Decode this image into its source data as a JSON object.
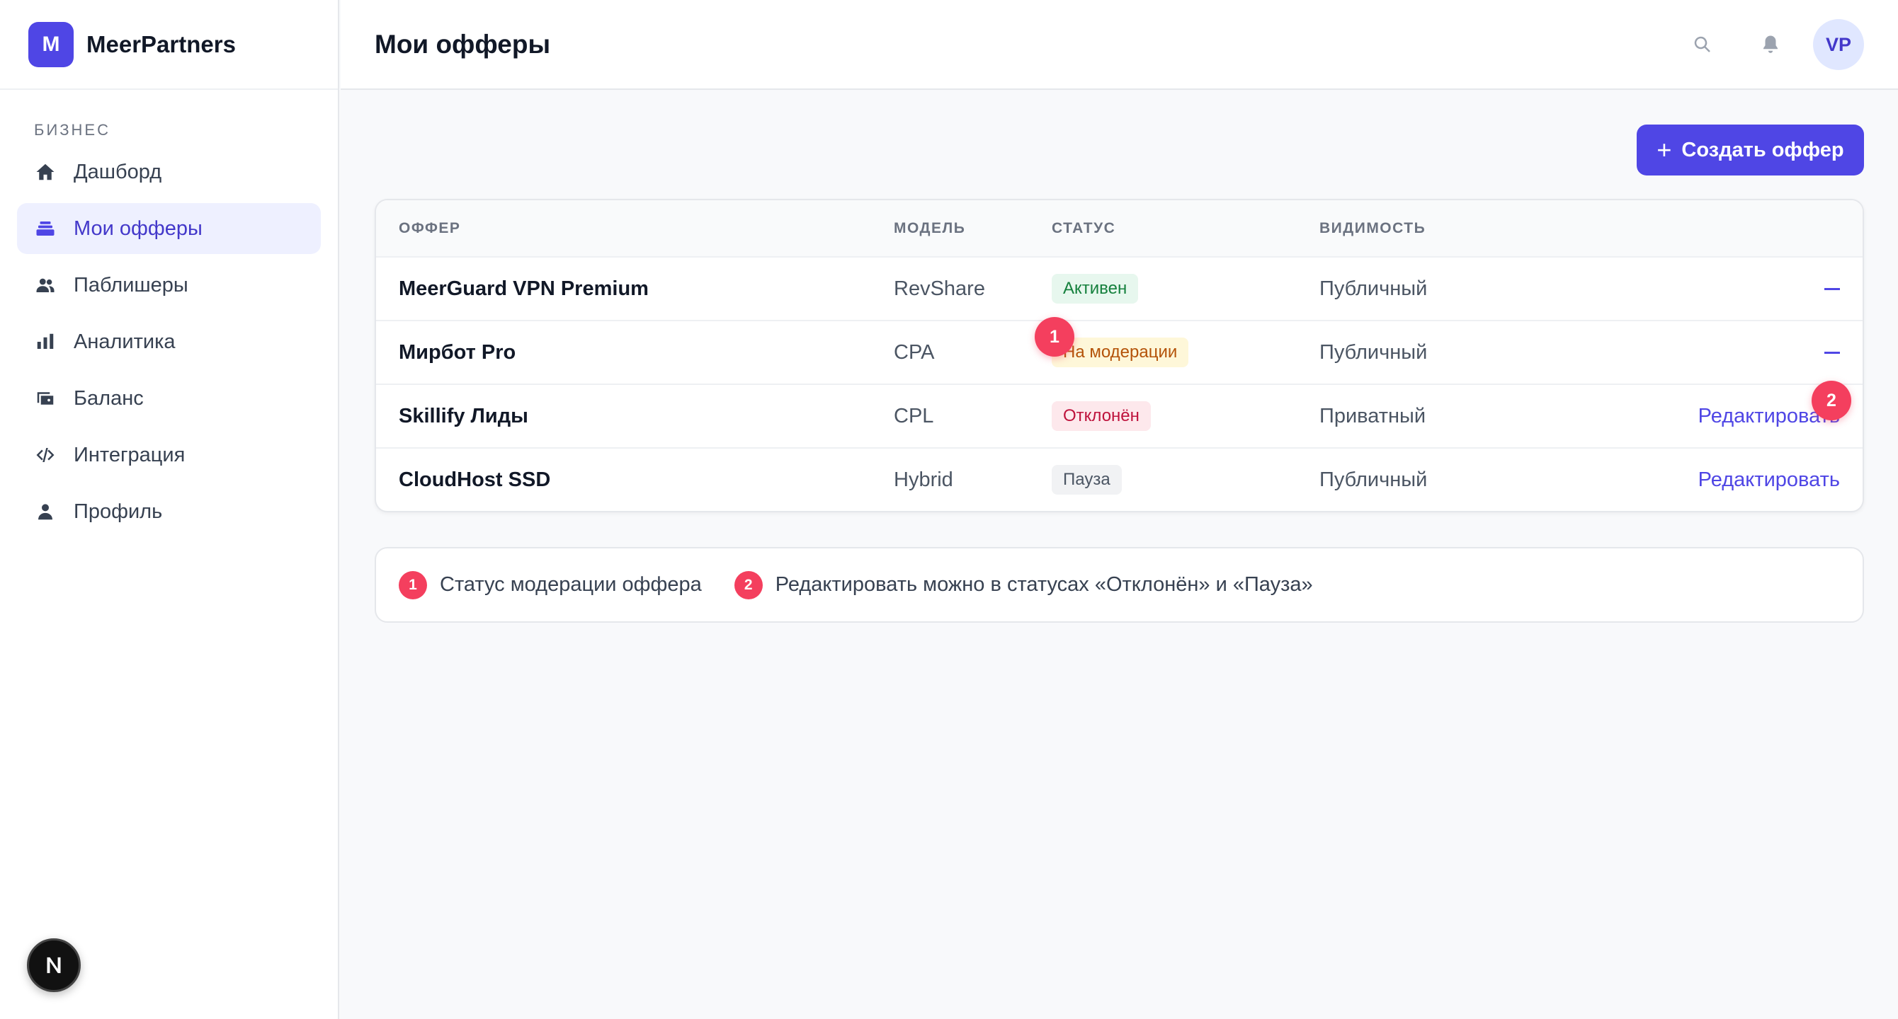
{
  "brand": {
    "logo_letter": "M",
    "name": "MeerPartners"
  },
  "sidebar": {
    "section_label": "БИЗНЕС",
    "items": [
      {
        "label": "Дашборд",
        "icon": "home-icon",
        "active": false
      },
      {
        "label": "Мои офферы",
        "icon": "stack-icon",
        "active": true
      },
      {
        "label": "Паблишеры",
        "icon": "users-icon",
        "active": false
      },
      {
        "label": "Аналитика",
        "icon": "bar-chart-icon",
        "active": false
      },
      {
        "label": "Баланс",
        "icon": "wallet-icon",
        "active": false
      },
      {
        "label": "Интеграция",
        "icon": "code-icon",
        "active": false
      },
      {
        "label": "Профиль",
        "icon": "user-icon",
        "active": false
      }
    ],
    "dev_badge": "N"
  },
  "header": {
    "title": "Мои офферы",
    "avatar_initials": "VP"
  },
  "toolbar": {
    "create_plus": "+",
    "create_label": "Создать оффер"
  },
  "table": {
    "columns": [
      "ОФФЕР",
      "МОДЕЛЬ",
      "СТАТУС",
      "ВИДИМОСТЬ"
    ],
    "rows": [
      {
        "offer": "MeerGuard VPN Premium",
        "model": "RevShare",
        "status": "Активен",
        "status_kind": "green",
        "visibility": "Публичный",
        "action": "—",
        "action_kind": "dash"
      },
      {
        "offer": "Мирбот Pro",
        "model": "CPA",
        "status": "На модерации",
        "status_kind": "yellow",
        "visibility": "Публичный",
        "action": "—",
        "action_kind": "dash"
      },
      {
        "offer": "Skillify Лиды",
        "model": "CPL",
        "status": "Отклонён",
        "status_kind": "red",
        "visibility": "Приватный",
        "action": "Редактировать",
        "action_kind": "link"
      },
      {
        "offer": "CloudHost SSD",
        "model": "Hybrid",
        "status": "Пауза",
        "status_kind": "gray",
        "visibility": "Публичный",
        "action": "Редактировать",
        "action_kind": "link"
      }
    ]
  },
  "markers": [
    "1",
    "2"
  ],
  "legend": [
    {
      "num": "1",
      "text": "Статус модерации оффера"
    },
    {
      "num": "2",
      "text": "Редактировать можно в статусах «Отклонён» и «Пауза»"
    }
  ],
  "colors": {
    "accent": "#4f46e5",
    "marker": "#f43f5e"
  }
}
